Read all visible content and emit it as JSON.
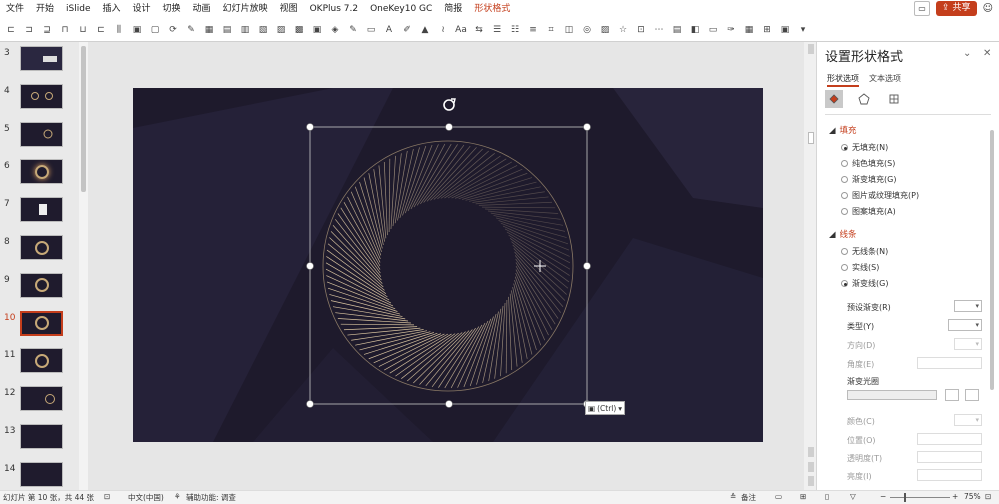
{
  "menubar": {
    "items": [
      "文件",
      "开始",
      "iSlide",
      "插入",
      "设计",
      "切换",
      "动画",
      "幻灯片放映",
      "视图",
      "OKPlus 7.2",
      "OneKey10 GC",
      "简报",
      "形状格式"
    ],
    "active_index": 12,
    "share_label": "共享"
  },
  "thumbnails": [
    {
      "num": "3",
      "kind": "dots"
    },
    {
      "num": "4",
      "kind": "rings"
    },
    {
      "num": "5",
      "kind": "ring-small"
    },
    {
      "num": "6",
      "kind": "glow"
    },
    {
      "num": "7",
      "kind": "panel"
    },
    {
      "num": "8",
      "kind": "ring"
    },
    {
      "num": "9",
      "kind": "ring"
    },
    {
      "num": "10",
      "kind": "ring",
      "selected": true
    },
    {
      "num": "11",
      "kind": "ring"
    },
    {
      "num": "12",
      "kind": "list"
    },
    {
      "num": "13",
      "kind": "dark"
    },
    {
      "num": "14",
      "kind": "dark"
    }
  ],
  "canvas": {
    "paste_tag_label": "(Ctrl)"
  },
  "panel": {
    "title": "设置形状格式",
    "tab_shape": "形状选项",
    "tab_text": "文本选项",
    "fill_section": "填充",
    "fill_options": [
      "无填充(N)",
      "纯色填充(S)",
      "渐变填充(G)",
      "图片或纹理填充(P)",
      "图案填充(A)"
    ],
    "fill_selected": 0,
    "line_section": "线条",
    "line_options": [
      "无线条(N)",
      "实线(S)",
      "渐变线(G)"
    ],
    "line_selected": 2,
    "preset_gradient": "预设渐变(R)",
    "type": "类型(Y)",
    "direction": "方向(D)",
    "angle": "角度(E)",
    "gradient_stops": "渐变光圈",
    "color": "颜色(C)",
    "position": "位置(O)",
    "transparency": "透明度(T)",
    "brightness": "亮度(I)"
  },
  "status": {
    "slide_info": "幻灯片 第 10 张，共 44 张",
    "language": "中文(中国)",
    "accessibility": "辅助功能: 调查",
    "notes": "备注",
    "zoom": "75%"
  },
  "colors": {
    "accent": "#c43e1c",
    "slide_bg": "#1e1a2c",
    "ray": "#e6d0a8"
  }
}
